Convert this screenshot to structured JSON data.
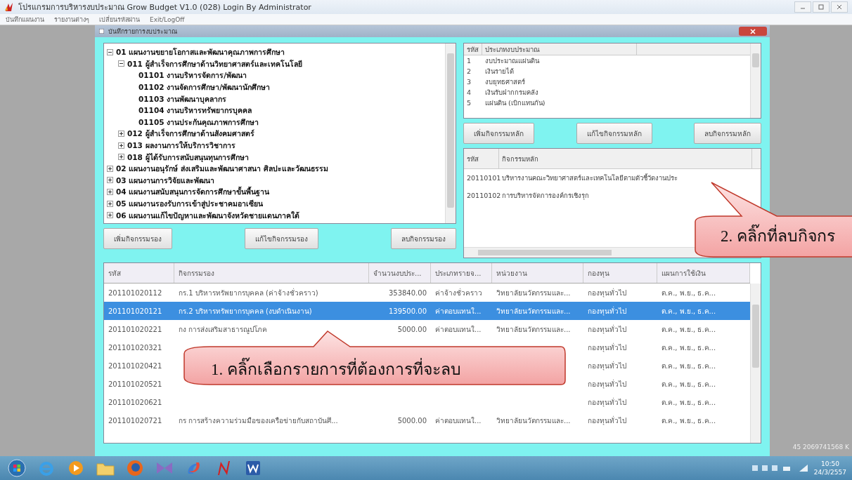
{
  "window": {
    "title": "โปรแกรมการบริหารงบประมาณ Grow Budget V1.0 (028)  Login By Administrator"
  },
  "menu": [
    "บันทึกแผนงาน",
    "รายงานต่างๆ",
    "เปลี่ยนรหัสผ่าน",
    "Exit/LogOff"
  ],
  "child_window": {
    "title": "บันทึกรายการงบประมาณ"
  },
  "tree": [
    {
      "label": "01 แผนงานขยายโอกาสและพัฒนาคุณภาพการศึกษา",
      "expanded": true,
      "children": [
        {
          "label": "011 ผู้สำเร็จการศึกษาด้านวิทยาศาสตร์และเทคโนโลยี",
          "expanded": true,
          "children": [
            {
              "label": "01101 งานบริหารจัดการ/พัฒนา"
            },
            {
              "label": "01102 งานจัดการศึกษา/พัฒนานักศึกษา"
            },
            {
              "label": "01103 งานพัฒนาบุคลากร"
            },
            {
              "label": "01104 งานบริหารทรัพยากรบุคคล"
            },
            {
              "label": "01105 งานประกันคุณภาพการศึกษา"
            }
          ]
        },
        {
          "label": "012 ผู้สำเร็จการศึกษาด้านสังคมศาสตร์",
          "expanded": false
        },
        {
          "label": "013 ผลงานการให้บริการวิชาการ",
          "expanded": false
        },
        {
          "label": "018 ผู้ได้รับการสนับสนุนทุนการศึกษา",
          "expanded": false
        }
      ]
    },
    {
      "label": "02 แผนงานอนุรักษ์ ส่งเสริมและพัฒนาศาสนา ศิลปะและวัฒนธรรม",
      "expanded": false
    },
    {
      "label": "03 แผนงานการวิจัยและพัฒนา",
      "expanded": false
    },
    {
      "label": "04 แผนงานสนับสนุนการจัดการศึกษาขั้นพื้นฐาน",
      "expanded": false
    },
    {
      "label": "05 แผนงานรองรับการเข้าสู่ประชาคมอาเซียน",
      "expanded": false
    },
    {
      "label": "06 แผนงานแก้ไขปัญหาและพัฒนาจังหวัดชายแดนภาคใต้",
      "expanded": false
    }
  ],
  "sub_activity_buttons": [
    "เพิ่มกิจกรรมรอง",
    "แก้ไขกิจกรรมรอง",
    "ลบกิจกรรมรอง"
  ],
  "budget_types": {
    "columns": [
      "รหัส",
      "ประเภทงบประมาณ"
    ],
    "rows": [
      [
        "1",
        "งบประมาณแผ่นดิน"
      ],
      [
        "2",
        "เงินรายได้"
      ],
      [
        "3",
        "งบยุทธศาสตร์"
      ],
      [
        "4",
        "เงินรับฝากกรมคลัง"
      ],
      [
        "5",
        "แผ่นดิน (เบิกแทนกัน)"
      ]
    ]
  },
  "main_activity_buttons": [
    "เพิ่มกิจกรรมหลัก",
    "แก้ไขกิจกรรมหลัก",
    "ลบกิจกรรมหลัก"
  ],
  "main_activities": {
    "columns": [
      "รหัส",
      "กิจกรรมหลัก"
    ],
    "rows": [
      [
        "20110101",
        "บริหารงานคณะวิทยาศาสตร์และเทคโนโลยีตามตัวชี้วัดงานประ"
      ],
      [
        "20110102",
        "การบริหารจัดการองค์กรเชิงรุก"
      ]
    ]
  },
  "sub_activities": {
    "columns": [
      "รหัส",
      "กิจกรรมรอง",
      "จำนวนงบประ...",
      "ประเภทรายจ...",
      "หน่วยงาน",
      "กองทุน",
      "แผนการใช้เงิน"
    ],
    "rows": [
      {
        "selected": false,
        "cells": [
          "201101020112",
          "กร.1 บริหารทรัพยากรบุคคล (ค่าจ้างชั่วคราว)",
          "353840.00",
          "ค่าจ้างชั่วคราว",
          "วิทยาลัยนวัตกรรมและ...",
          "กองทุนทั่วไป",
          "ต.ค., พ.ย., ธ.ค..."
        ]
      },
      {
        "selected": true,
        "cells": [
          "201101020121",
          "กร.2 บริหารทรัพยากรบุคคล (งบดำเนินงาน)",
          "139500.00",
          "ค่าตอบแทนใ...",
          "วิทยาลัยนวัตกรรมและ...",
          "กองทุนทั่วไป",
          "ต.ค., พ.ย., ธ.ค..."
        ]
      },
      {
        "selected": false,
        "cells": [
          "201101020221",
          "กง การส่งเสริมสาธารณูปโภค",
          "5000.00",
          "ค่าตอบแทนใ...",
          "วิทยาลัยนวัตกรรมและ...",
          "กองทุนทั่วไป",
          "ต.ค., พ.ย., ธ.ค..."
        ]
      },
      {
        "selected": false,
        "cells": [
          "201101020321",
          null,
          null,
          null,
          null,
          "กองทุนทั่วไป",
          "ต.ค., พ.ย., ธ.ค..."
        ]
      },
      {
        "selected": false,
        "cells": [
          "201101020421",
          null,
          null,
          null,
          null,
          "กองทุนทั่วไป",
          "ต.ค., พ.ย., ธ.ค..."
        ]
      },
      {
        "selected": false,
        "cells": [
          "201101020521",
          null,
          null,
          null,
          null,
          "กองทุนทั่วไป",
          "ต.ค., พ.ย., ธ.ค..."
        ]
      },
      {
        "selected": false,
        "cells": [
          "201101020621",
          null,
          null,
          null,
          null,
          "กองทุนทั่วไป",
          "ต.ค., พ.ย., ธ.ค..."
        ]
      },
      {
        "selected": false,
        "cells": [
          "201101020721",
          "กร การสร้างความร่วมมือของเครือข่ายกับสถาบันศึ...",
          "5000.00",
          "ค่าตอบแทนใ...",
          "วิทยาลัยนวัตกรรมและ...",
          "กองทุนทั่วไป",
          "ต.ค., พ.ย., ธ.ค..."
        ]
      }
    ]
  },
  "status_text": "45  2069741568 K",
  "callouts": [
    {
      "text": "1. คลิ๊กเลือกรายการที่ต้องการที่จะลบ"
    },
    {
      "text": "2. คลิ๊กที่ลบกิจกร"
    }
  ],
  "taskbar": {
    "time": "10:50",
    "date": "24/3/2557"
  }
}
